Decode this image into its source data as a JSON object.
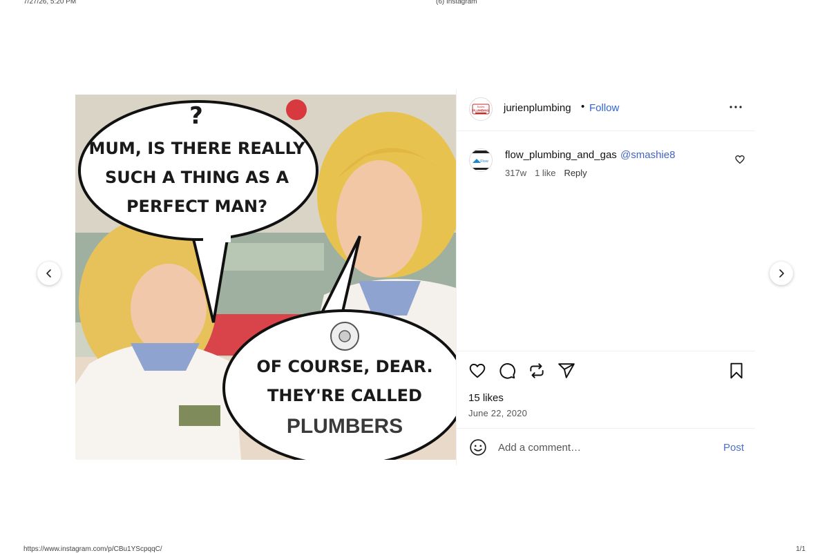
{
  "print": {
    "date": "7/27/26, 5:20 PM",
    "title": "(6) Instagram",
    "url": "https://www.instagram.com/p/CBu1YScpqqC/",
    "page": "1/1"
  },
  "post": {
    "username": "jurienplumbing",
    "separator": "•",
    "follow_label": "Follow",
    "image": {
      "question_mark": "?",
      "bubble_top": [
        "MUM, IS THERE REALLY",
        "SUCH A THING AS A",
        "PERFECT MAN?"
      ],
      "bubble_bottom": [
        "OF COURSE, DEAR.",
        "THEY'RE CALLED",
        "PLUMBERS"
      ]
    },
    "avatar_text": [
      "Jurien",
      "PLUMBING"
    ],
    "comment": {
      "username": "flow_plumbing_and_gas",
      "mention": "@smashie8",
      "age": "317w",
      "likes": "1 like",
      "reply_label": "Reply",
      "avatar_text": "Flow"
    },
    "likes": "15 likes",
    "date": "June 22, 2020",
    "add_comment_placeholder": "Add a comment…",
    "post_label": "Post"
  },
  "icons": {
    "prev": "chevron-left-icon",
    "next": "chevron-right-icon",
    "more": "more-options-icon",
    "heart": "heart-icon",
    "comment": "comment-icon",
    "repost": "repost-icon",
    "share": "send-icon",
    "save": "bookmark-icon",
    "emoji": "emoji-icon"
  },
  "colors": {
    "link_blue": "#2f64d6",
    "border": "#efefef"
  }
}
